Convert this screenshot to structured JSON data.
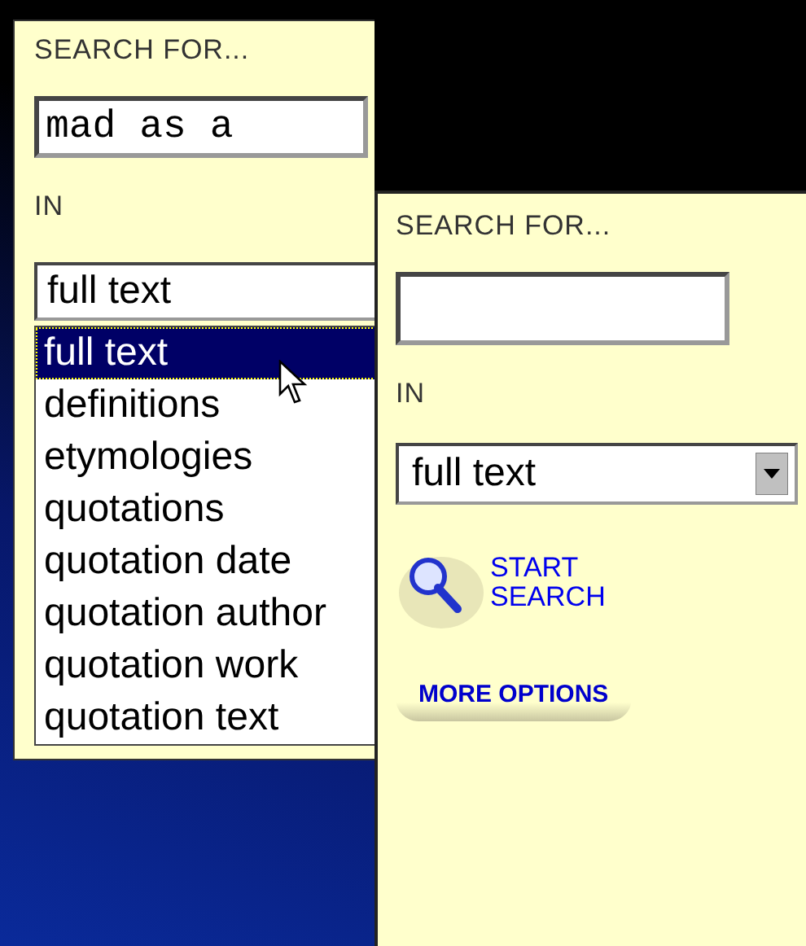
{
  "back_panel": {
    "search_label": "SEARCH FOR...",
    "query": "mad as a",
    "in_label": "IN",
    "scope": "full text",
    "dropdown": [
      {
        "label": "full text",
        "selected": true
      },
      {
        "label": "definitions",
        "selected": false
      },
      {
        "label": "etymologies",
        "selected": false
      },
      {
        "label": "quotations",
        "selected": false
      },
      {
        "label": "quotation date",
        "selected": false
      },
      {
        "label": "quotation author",
        "selected": false
      },
      {
        "label": "quotation work",
        "selected": false
      },
      {
        "label": "quotation text",
        "selected": false
      }
    ]
  },
  "front_panel": {
    "search_label": "SEARCH FOR...",
    "in_label": "IN",
    "scope": "full text",
    "start_search": "START SEARCH",
    "more_options": "MORE OPTIONS"
  }
}
